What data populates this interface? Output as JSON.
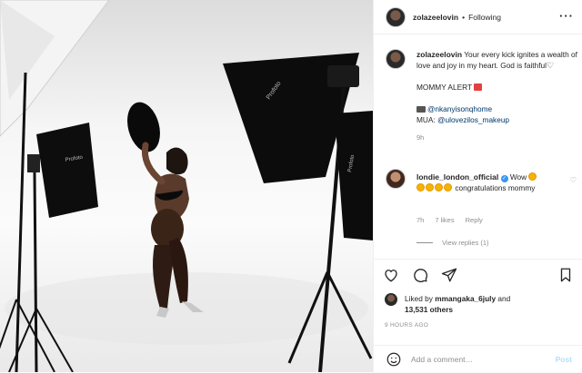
{
  "header": {
    "username": "zolazeelovin",
    "separator": "•",
    "follow_status": "Following",
    "more_icon": "more-horizontal-icon"
  },
  "caption": {
    "username": "zolazeelovin",
    "text": "Your every kick ignites a wealth of love and joy in my heart. God is faithful",
    "alert": "MOMMY ALERT",
    "photo_credit": "@nkanyisonqhome",
    "mua_label": "MUA:",
    "mua_credit": "@ulovezilos_makeup",
    "time": "9h"
  },
  "comment": {
    "username": "londie_london_official",
    "text_start": "Wow",
    "text_end": "congratulations mommy",
    "time": "7h",
    "likes": "7 likes",
    "reply": "Reply",
    "view_replies": "View replies (1)"
  },
  "actions": {
    "liked_by_prefix": "Liked by",
    "liked_by_user": "mmangaka_6july",
    "liked_by_and": "and",
    "others": "13,531 others",
    "posted_ago": "9 HOURS AGO"
  },
  "add_comment": {
    "placeholder": "Add a comment…",
    "post_label": "Post"
  },
  "colors": {
    "link": "#00376b",
    "verified": "#3897f0",
    "post_disabled": "#b2dffc"
  }
}
